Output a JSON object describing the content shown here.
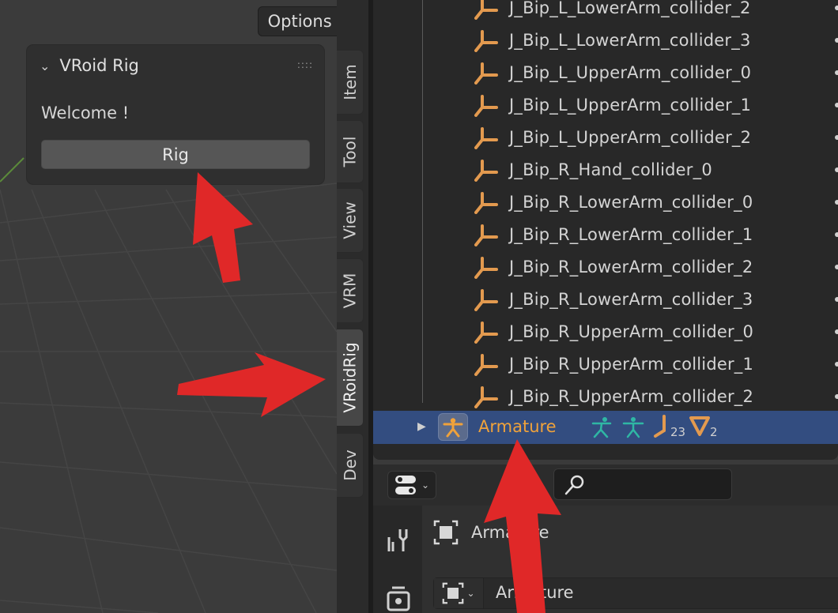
{
  "viewport": {
    "options_label": "Options",
    "panel": {
      "title": "VRoid Rig",
      "welcome_text": "Welcome !",
      "rig_button_label": "Rig"
    }
  },
  "sidebar_tabs": [
    {
      "label": "Item",
      "active": false
    },
    {
      "label": "Tool",
      "active": false
    },
    {
      "label": "View",
      "active": false
    },
    {
      "label": "VRM",
      "active": false
    },
    {
      "label": "VRoidRig",
      "active": true
    },
    {
      "label": "Dev",
      "active": false
    }
  ],
  "outliner": {
    "rows": [
      "J_Bip_L_LowerArm_collider_2",
      "J_Bip_L_LowerArm_collider_3",
      "J_Bip_L_UpperArm_collider_0",
      "J_Bip_L_UpperArm_collider_1",
      "J_Bip_L_UpperArm_collider_2",
      "J_Bip_R_Hand_collider_0",
      "J_Bip_R_LowerArm_collider_0",
      "J_Bip_R_LowerArm_collider_1",
      "J_Bip_R_LowerArm_collider_2",
      "J_Bip_R_LowerArm_collider_3",
      "J_Bip_R_UpperArm_collider_0",
      "J_Bip_R_UpperArm_collider_1",
      "J_Bip_R_UpperArm_collider_2"
    ],
    "armature": {
      "label": "Armature",
      "bone_count": "23",
      "mesh_count": "2"
    }
  },
  "properties": {
    "search_value": "",
    "object_name": "Armature",
    "data_name": "Armature"
  },
  "colors": {
    "selected_row": "#334d80",
    "armature_text": "#f0a23a",
    "bone_icon": "#e39a4f",
    "pose_icon": "#2fb7a4",
    "arrow": "#e02828"
  }
}
